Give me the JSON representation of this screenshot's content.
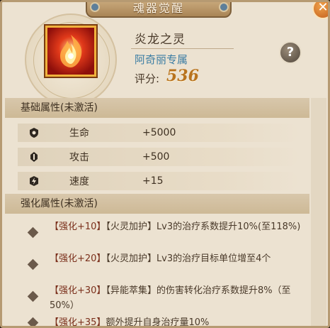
{
  "header": {
    "title": "魂器觉醒"
  },
  "item": {
    "name": "炎龙之灵",
    "exclusive": "阿奇丽专属",
    "score_label": "评分:",
    "score_value": "536",
    "icon": "flame-dragon-icon"
  },
  "basic": {
    "title": "基础属性(未激活)",
    "stats": [
      {
        "icon": "shield-icon",
        "name": "生命",
        "value": "+5000"
      },
      {
        "icon": "attack-icon",
        "name": "攻击",
        "value": "+500"
      },
      {
        "icon": "speed-icon",
        "name": "速度",
        "value": "+15"
      }
    ]
  },
  "enhanced": {
    "title": "强化属性(未激活)",
    "items": [
      {
        "tag": "【强化+10】",
        "text": "【火灵加护】Lv3的治疗系数提升10%(至118%)"
      },
      {
        "tag": "【强化+20】",
        "text": "【火灵加护】Lv3的治疗目标单位增至4个"
      },
      {
        "tag": "【强化+30】",
        "text": "【异能萃集】的伤害转化治疗系数提升8%（至50%）"
      },
      {
        "tag": "【强化+35】",
        "text": "额外提升自身治疗量10%"
      }
    ]
  },
  "colors": {
    "panel": "#ece2d1",
    "accent_score": "#b8731e",
    "exclusive": "#3a7ca3"
  }
}
